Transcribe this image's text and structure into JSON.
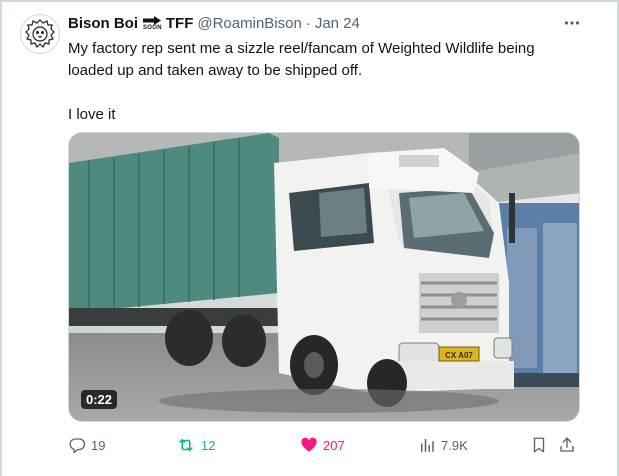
{
  "author": {
    "name": "Bison Boi",
    "badge_text": "SOON",
    "badge_suffix": "TFF",
    "handle": "@RoaminBison",
    "separator": "·",
    "date": "Jan 24"
  },
  "tweet": {
    "text": "My factory rep sent me a sizzle reel/fancam of Weighted Wildlife being loaded up and taken away to be shipped off.\n\nI love it"
  },
  "media": {
    "duration": "0:22",
    "plate": "CX A07"
  },
  "actions": {
    "replies": "19",
    "retweets": "12",
    "likes": "207",
    "views": "7.9K"
  },
  "colors": {
    "text_primary": "#0f1419",
    "text_secondary": "#536471",
    "retweet": "#00ba7c",
    "like": "#f91880"
  }
}
